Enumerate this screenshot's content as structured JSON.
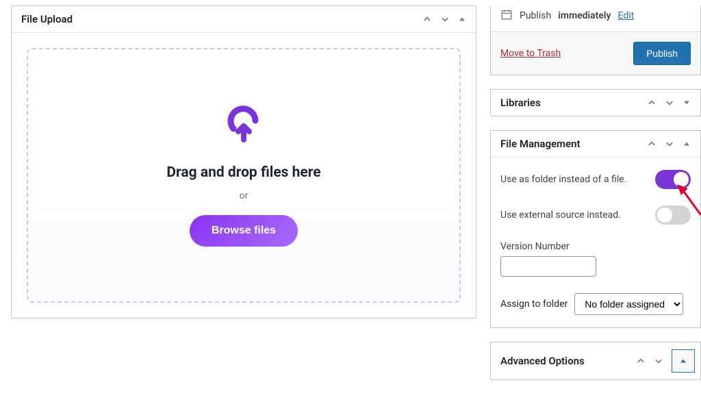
{
  "upload_box": {
    "title": "File Upload",
    "heading": "Drag and drop files here",
    "or": "or",
    "browse_label": "Browse files"
  },
  "publish_box": {
    "prefix": "Publish",
    "when": "immediately",
    "edit": "Edit",
    "trash": "Move to Trash",
    "publish_btn": "Publish"
  },
  "libraries_box": {
    "title": "Libraries"
  },
  "file_mgmt": {
    "title": "File Management",
    "folder_toggle_label": "Use as folder instead of a file.",
    "external_toggle_label": "Use external source instead.",
    "version_label": "Version Number",
    "assign_label": "Assign to folder",
    "assign_selected": "No folder assigned"
  },
  "advanced_box": {
    "title": "Advanced Options"
  }
}
